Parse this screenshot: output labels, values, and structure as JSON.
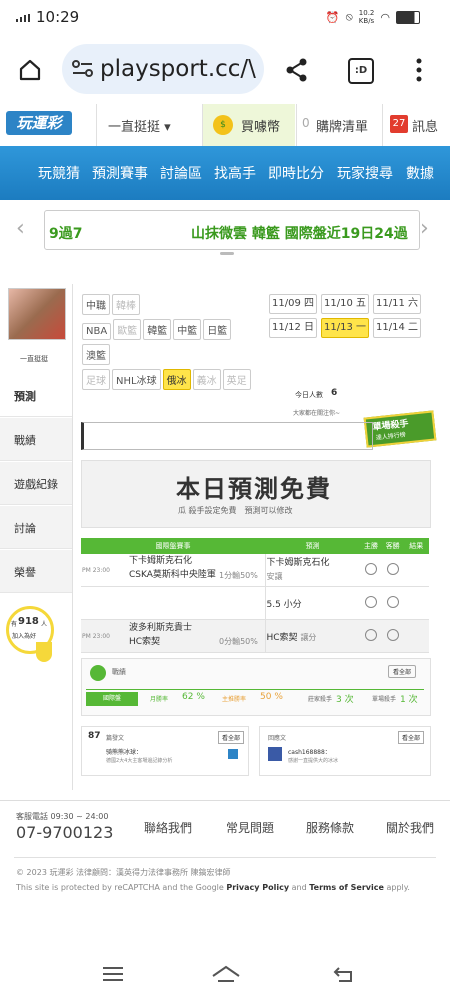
{
  "status": {
    "time": "10:29",
    "net": "10.2\nKB/s"
  },
  "browser": {
    "url": "playsport.cc/\\"
  },
  "header": {
    "logo": "玩運彩",
    "menu": "一直挺挺 ▾",
    "coins": "買噱幣",
    "cart_count": "0",
    "cart": "購牌清單",
    "msg_count": "27",
    "msg": "訊息"
  },
  "nav": [
    "玩競猜",
    "預測賽事",
    "討論區",
    "找高手",
    "即時比分",
    "玩家搜尋",
    "數據"
  ],
  "ticker": {
    "left": "9過7",
    "right": "山抹微雲 韓籃 國際盤近19日24過"
  },
  "user": {
    "name": "一直挺挺"
  },
  "sidebar": [
    "預測",
    "戰績",
    "遊戲紀錄",
    "討論",
    "榮譽"
  ],
  "helper": {
    "prefix": "有",
    "count": "918",
    "suffix": "人",
    "line2": "加入為好"
  },
  "leagues": {
    "row1": [
      "中職",
      "韓棒"
    ],
    "row2": [
      "NBA",
      "歐籃",
      "韓籃",
      "中籃",
      "日籃"
    ],
    "row3": [
      "澳籃"
    ],
    "row4": [
      "足球",
      "NHL冰球",
      "俄冰",
      "義冰",
      "英足"
    ]
  },
  "dates": [
    "11/09 四",
    "11/10 五",
    "11/11 六",
    "11/12 日",
    "11/13 一",
    "11/14 二"
  ],
  "today": {
    "label": "今日人數",
    "count": "6",
    "sub": "大家都在關注你~"
  },
  "badge": {
    "title": "單場殺手",
    "sub": "達人排行榜"
  },
  "banner": {
    "title": "本日預測免費",
    "sub": "瓜 殺手設定免費　預測可以修改"
  },
  "table": {
    "headers": [
      "國際盤賽事",
      "預測",
      "主勝",
      "客勝",
      "結果"
    ],
    "rows": [
      {
        "time": "PM 23:00",
        "team1": "下卡姆斯克石化",
        "team2": "CSKA莫斯科中央陸軍",
        "ratio": "1分輸50%",
        "pick1": "下卡姆斯克石化",
        "pick1b": "安讓",
        "pick2": "5.5 小分"
      },
      {
        "time": "PM 23:00",
        "team1": "波多利斯克貴士",
        "team2": "HC索契",
        "ratio": "0分輸50%",
        "pick1": "HC索契",
        "pick1b": "讓分",
        "pick2": ""
      }
    ]
  },
  "stats": {
    "title": "戰績",
    "button": "看全部",
    "items": [
      {
        "label": "國際盤",
        "value": ""
      },
      {
        "label": "月勝率",
        "value": "62 %"
      },
      {
        "label": "主推勝率",
        "value": "50 %"
      },
      {
        "label": "莊家殺手",
        "value": "3 次"
      },
      {
        "label": "單場殺手",
        "value": "1 次"
      }
    ]
  },
  "posts": {
    "left_count": "87",
    "left_title": "篇發文",
    "left_btn": "看全部",
    "left_item": "骑熊熊冰球：",
    "left_item2": "德國2大4大主客場邊記錄分析",
    "right_title": "回應文",
    "right_btn": "看全部",
    "right_item": "cash168888：",
    "right_item2": "感謝一直提供大的冰冰"
  },
  "footer": {
    "service": "客服電話 09:30 ~ 24:00",
    "phone": "07-9700123",
    "links": [
      "聯絡我們",
      "常見問題",
      "服務條款",
      "關於我們"
    ],
    "copyright": "© 2023 玩運彩 法律顧問：漢英得力法律事務所 陳鎬宏律師",
    "recaptcha1": "This site is protected by reCAPTCHA and the Google",
    "privacy": "Privacy Policy",
    "and": "and",
    "terms": "Terms of Service",
    "apply": "apply."
  },
  "colors": {
    "nav": "#1c7cc0",
    "accent_green": "#56b836",
    "highlight": "#ffe44a",
    "phone": "#444444"
  }
}
